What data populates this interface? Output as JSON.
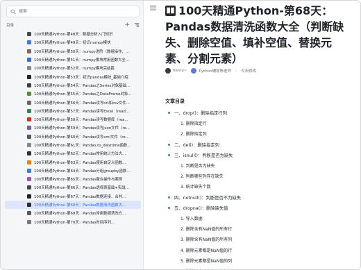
{
  "search": {
    "placeholder": "搜索"
  },
  "directory": {
    "label": "目录",
    "add_icon": "plus-icon",
    "sort_icon": "sort-icon"
  },
  "sidebar_items": [
    {
      "label": "100天精通Python-第48天：数据分析入门知识",
      "color": "#4a4a4a"
    },
    {
      "label": "100天精通Python-第49天：初识numpy模块",
      "color": "#3b7dd8"
    },
    {
      "label": "100天精通Python-第50天：numpy进阶（数组操作、...",
      "color": "#7a6a5a"
    },
    {
      "label": "100天精通Python-第51天：numpy模块常用函数大全...",
      "color": "#3a6fcf"
    },
    {
      "label": "100天精通Python-第52天：numpy模块完结篇",
      "color": "#8a8a8a"
    },
    {
      "label": "100天精通Python-第53天：初识pandas模块_基础介绍",
      "color": "#222222"
    },
    {
      "label": "100天精通Python-第54天：Pandas之Series对象基础...",
      "color": "#3d3d3d"
    },
    {
      "label": "100天精通Python-第55天：Pandas之DataFrame对象...",
      "color": "#5d8c3a"
    },
    {
      "label": "100天精通Python-第56天：Pandas读写txt和csv文件...",
      "color": "#666666"
    },
    {
      "label": "100天精通Python-第57天：Pandas读写Excel（read...",
      "color": "#2e8b57"
    },
    {
      "label": "100天精通Python-第58天：Pandas读写数据库（rea...",
      "color": "#c0392b"
    },
    {
      "label": "100天精通Python-第59天：Pandas读写json文件（re...",
      "color": "#7b5ea7"
    },
    {
      "label": "100天精通Python-第60天：Pandas读写xml文件（re...",
      "color": "#555555"
    },
    {
      "label": "100天精通Python-第61天：Pandas.to_datetime函数...",
      "color": "#888888"
    },
    {
      "label": "100天精通Python-第62天：Pandas常用统计方法大...",
      "color": "#2f2f2f"
    },
    {
      "label": "100天精通Python-第63天：Pandas使用自定义函数...",
      "color": "#e67e22"
    },
    {
      "label": "100天精通Python-第64天：Pandas分组groupby函数...",
      "color": "#3b7dd8"
    },
    {
      "label": "100天精通Python-第65天：Pandas聚合操作与案例",
      "color": "#9b59b6"
    },
    {
      "label": "100天精通Python-第66天：Pandas透视表基础+实战...",
      "color": "#4a4a4a"
    },
    {
      "label": "100天精通Python-第67天：Pandas数据连接、合并...",
      "color": "#1f1f1f"
    },
    {
      "label": "100天精通Python-第68天：Pandas数据清洗函数大...",
      "color": "#2b2b2b",
      "selected": true
    },
    {
      "label": "100天精通Python-第69天：Pandas常用数据清洗方...",
      "color": "#5a5a5a"
    },
    {
      "label": "100天精通Python-第70天：Pandas时间序列...",
      "color": "#7a7a7a"
    }
  ],
  "main": {
    "menu_icon": "menu-icon",
    "title_icon": "book-icon",
    "title": "100天精通Python-第68天：Pandas数据清洗函数大全（判断缺失、删除空值、填补空值、替换元素、分割元素）",
    "author": "henry",
    "author_suffix": "~",
    "collaborator": "Python辅导陈老师",
    "modified": "今天修改"
  },
  "toc": {
    "title": "文章目录",
    "items": [
      {
        "level": 1,
        "text": "一、drop()：删除指定行列"
      },
      {
        "level": 2,
        "text": "1. 删除指定行"
      },
      {
        "level": 2,
        "text": "2. 删除指定列"
      },
      {
        "level": 1,
        "text": "二、del()：删除指定列"
      },
      {
        "level": 1,
        "text": "三、isnull()：判断是否为缺失"
      },
      {
        "level": 2,
        "text": "1. 判断是否为缺失"
      },
      {
        "level": 2,
        "text": "2. 判断哪些列存在缺失"
      },
      {
        "level": 2,
        "text": "3. 统计缺失个数"
      },
      {
        "level": 1,
        "text": "四、notnull()：判断是否不为缺失"
      },
      {
        "level": 1,
        "text": "五、dropna()：删除缺失值"
      },
      {
        "level": 2,
        "text": "1. 导入数据"
      },
      {
        "level": 2,
        "text": "2. 删除含有NaN值的所有行"
      },
      {
        "level": 2,
        "text": "3. 删除含有NaN值的所有列"
      },
      {
        "level": 2,
        "text": "4. 删除元素都是NaN值的行"
      },
      {
        "level": 2,
        "text": "5. 删除元素都是NaN值的列"
      },
      {
        "level": 2,
        "text": "6. 删除指定列中含有缺失的行"
      }
    ]
  }
}
